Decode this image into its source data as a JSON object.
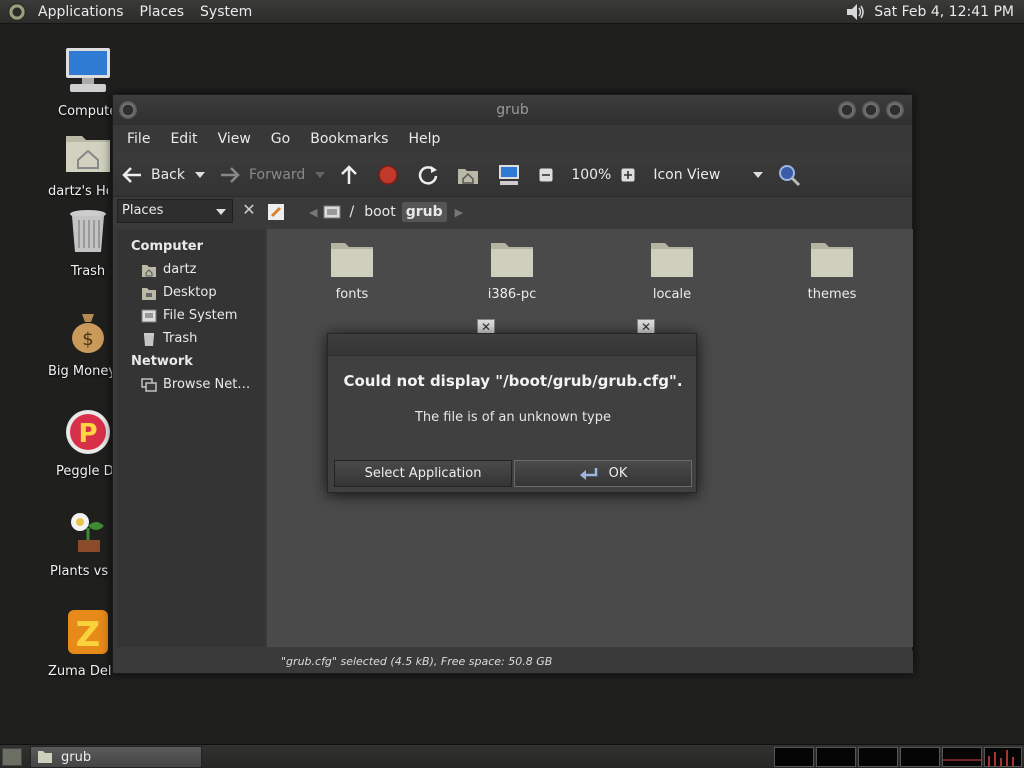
{
  "top_panel": {
    "menus": [
      "Applications",
      "Places",
      "System"
    ],
    "clock": "Sat Feb  4, 12:41 PM"
  },
  "desktop_icons": [
    {
      "label": "Computer",
      "icon": "computer-icon"
    },
    {
      "label": "dartz's Home",
      "icon": "home-folder-icon"
    },
    {
      "label": "Trash",
      "icon": "trash-icon"
    },
    {
      "label": "Big Money Deluxe",
      "icon": "money-bag-icon"
    },
    {
      "label": "Peggle Deluxe",
      "icon": "peggle-icon"
    },
    {
      "label": "Plants vs Zombies",
      "icon": "plants-icon"
    },
    {
      "label": "Zuma Deluxe",
      "icon": "zuma-icon"
    }
  ],
  "window": {
    "title": "grub",
    "menubar": [
      "File",
      "Edit",
      "View",
      "Go",
      "Bookmarks",
      "Help"
    ],
    "toolbar": {
      "back": "Back",
      "forward": "Forward",
      "zoom": "100%",
      "view_mode": "Icon View"
    },
    "sidebar": {
      "selector": "Places",
      "computer_heading": "Computer",
      "computer_items": [
        "dartz",
        "Desktop",
        "File System",
        "Trash"
      ],
      "network_heading": "Network",
      "network_items": [
        "Browse Net…"
      ]
    },
    "path": {
      "root": "/",
      "crumbs": [
        "boot",
        "grub"
      ]
    },
    "files": [
      "fonts",
      "i386-pc",
      "locale",
      "themes"
    ],
    "status": "\"grub.cfg\" selected (4.5 kB), Free space: 50.8 GB"
  },
  "dialog": {
    "primary": "Could not display \"/boot/grub/grub.cfg\".",
    "secondary": "The file is of an unknown type",
    "select_button": "Select Application",
    "ok_button": "OK"
  },
  "bottom_panel": {
    "task": "grub"
  },
  "colors": {
    "desktop": "#1f201e",
    "window_bg": "#3a3a3a",
    "iconview_bg": "#4a4a4a",
    "folder": "#c8c8b4",
    "stop_red": "#c0392b"
  }
}
